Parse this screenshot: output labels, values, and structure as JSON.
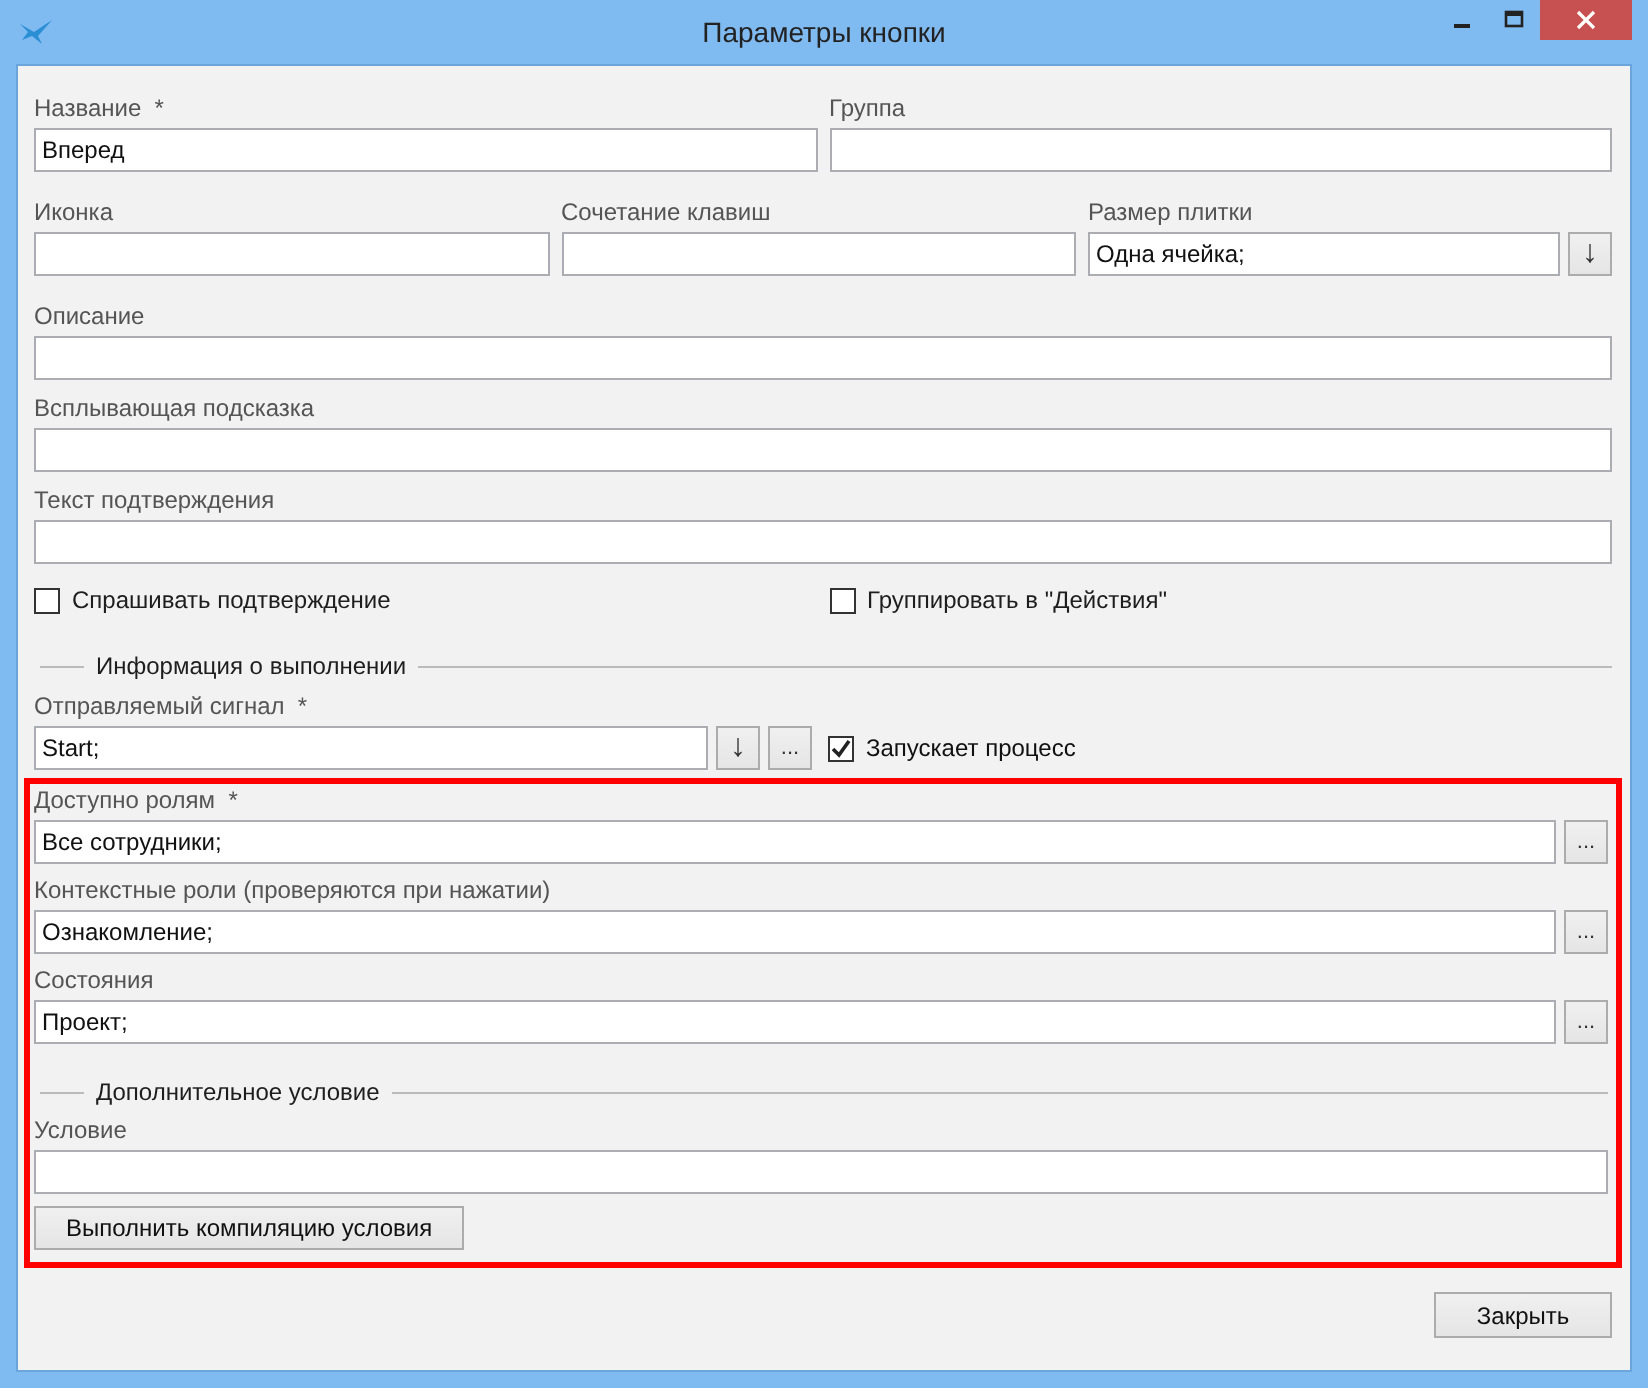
{
  "window": {
    "title": "Параметры кнопки"
  },
  "name": {
    "label": "Название",
    "mark": "*",
    "value": "Вперед"
  },
  "group": {
    "label": "Группа"
  },
  "icon": {
    "label": "Иконка"
  },
  "hotkey": {
    "label": "Сочетание клавиш"
  },
  "tile_size": {
    "label": "Размер плитки",
    "value": "Одна ячейка;",
    "dropdown_button": "↓"
  },
  "description": {
    "label": "Описание"
  },
  "tooltip": {
    "label": "Всплывающая подсказка"
  },
  "confirm_text": {
    "label": "Текст подтверждения"
  },
  "checkboxes": [
    {
      "label": "Спрашивать подтверждение",
      "checked": false
    },
    {
      "label": "Группировать в \"Действия\"",
      "checked": false
    }
  ],
  "execution_section": {
    "title": "Информация о выполнении"
  },
  "signal": {
    "label": "Отправляемый сигнал",
    "mark": "*",
    "value": "Start;",
    "dropdown_button": "↓",
    "browse_button": "...",
    "checkbox": {
      "label": "Запускает процесс",
      "checked": true
    }
  },
  "highlighted_area": {
    "highlighted": true,
    "fields": [
      {
        "label": "Доступно ролям",
        "mark": "*",
        "value": "Все сотрудники;",
        "browse_button": "..."
      },
      {
        "label": "Контекстные роли (проверяются при нажатии)",
        "value": "Ознакомление;",
        "browse_button": "..."
      },
      {
        "label": "Состояния",
        "value": "Проект;",
        "browse_button": "..."
      }
    ],
    "condition_section": {
      "title": "Дополнительное условие"
    },
    "condition": {
      "label": "Условие"
    },
    "compile_button": "Выполнить компиляцию условия"
  },
  "close_button": "Закрыть"
}
